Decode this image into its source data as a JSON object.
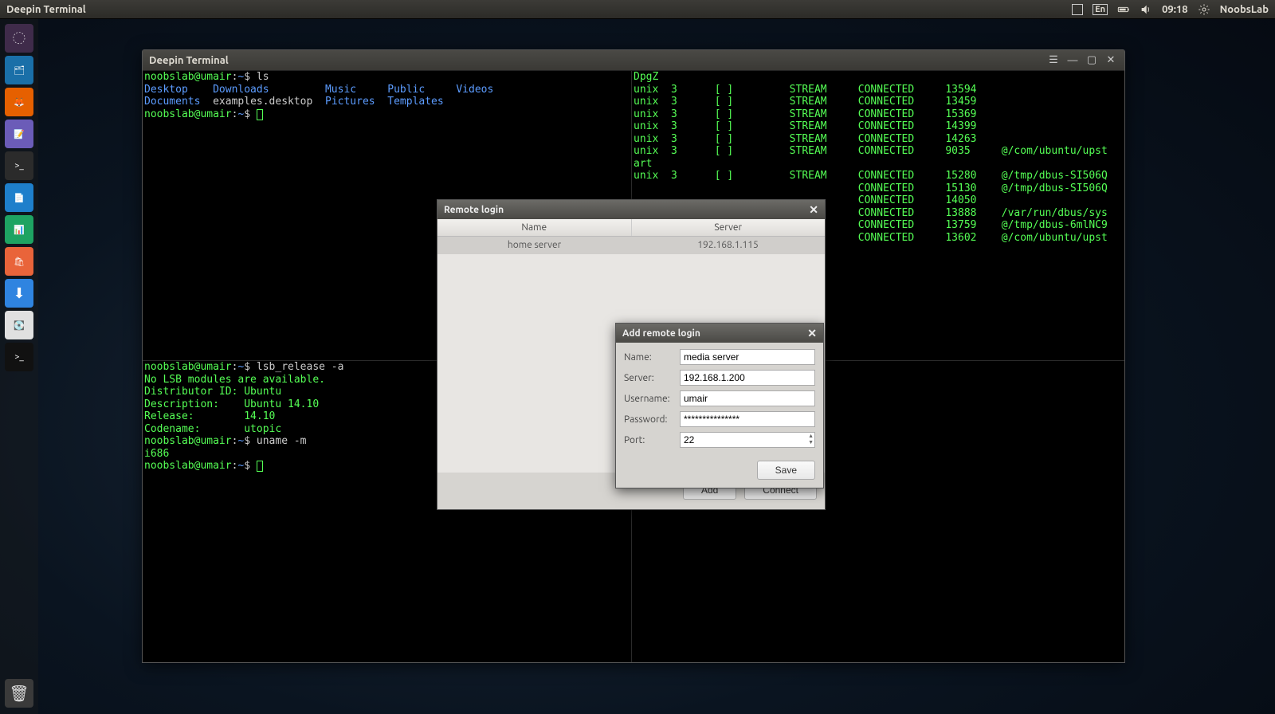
{
  "top_panel": {
    "app_title": "Deepin Terminal",
    "lang": "En",
    "time": "09:18",
    "user": "NoobsLab"
  },
  "launcher": {
    "items": [
      {
        "name": "ubuntu-dash",
        "bg": "#3f2b4a",
        "glyph": "◌"
      },
      {
        "name": "files",
        "bg": "#1a6fa8",
        "glyph": "🗂"
      },
      {
        "name": "firefox",
        "bg": "#e66000",
        "glyph": "🦊"
      },
      {
        "name": "editor",
        "bg": "#6b5cb8",
        "glyph": "📝"
      },
      {
        "name": "terminal",
        "bg": "#2b2b2b",
        "glyph": ">_"
      },
      {
        "name": "writer",
        "bg": "#1e7fcb",
        "glyph": "📄"
      },
      {
        "name": "calc",
        "bg": "#1ea362",
        "glyph": "📊"
      },
      {
        "name": "software",
        "bg": "#e9643a",
        "glyph": "🛍"
      },
      {
        "name": "download",
        "bg": "#2f84e0",
        "glyph": "⬇"
      },
      {
        "name": "disks",
        "bg": "#e0e0e0",
        "glyph": "💽"
      },
      {
        "name": "deepin-terminal",
        "bg": "#111",
        "glyph": ">_"
      }
    ],
    "trash_glyph": "🗑"
  },
  "terminal": {
    "title": "Deepin Terminal",
    "panes": {
      "top_left": [
        {
          "segs": [
            {
              "c": "g",
              "t": "noobslab@umair"
            },
            {
              "c": "w",
              "t": ":"
            },
            {
              "c": "b",
              "t": "~"
            },
            {
              "c": "w",
              "t": "$ ls"
            }
          ]
        },
        {
          "segs": [
            {
              "c": "b",
              "t": "Desktop    Downloads         Music     Public     Videos"
            }
          ]
        },
        {
          "segs": [
            {
              "c": "b",
              "t": "Documents"
            },
            {
              "c": "w",
              "t": "  examples.desktop  "
            },
            {
              "c": "b",
              "t": "Pictures  Templates"
            }
          ]
        },
        {
          "segs": [
            {
              "c": "g",
              "t": "noobslab@umair"
            },
            {
              "c": "w",
              "t": ":"
            },
            {
              "c": "b",
              "t": "~"
            },
            {
              "c": "w",
              "t": "$ "
            }
          ],
          "cursor": true
        }
      ],
      "top_right": [
        {
          "segs": [
            {
              "c": "g",
              "t": "DpgZ"
            }
          ]
        },
        {
          "segs": [
            {
              "c": "g",
              "t": "unix  3      [ ]         STREAM     CONNECTED     13594"
            }
          ]
        },
        {
          "segs": [
            {
              "c": "g",
              "t": "unix  3      [ ]         STREAM     CONNECTED     13459"
            }
          ]
        },
        {
          "segs": [
            {
              "c": "g",
              "t": "unix  3      [ ]         STREAM     CONNECTED     15369"
            }
          ]
        },
        {
          "segs": [
            {
              "c": "g",
              "t": "unix  3      [ ]         STREAM     CONNECTED     14399"
            }
          ]
        },
        {
          "segs": [
            {
              "c": "g",
              "t": "unix  3      [ ]         STREAM     CONNECTED     14263"
            }
          ]
        },
        {
          "segs": [
            {
              "c": "g",
              "t": "unix  3      [ ]         STREAM     CONNECTED     9035     @/com/ubuntu/upst"
            }
          ]
        },
        {
          "segs": [
            {
              "c": "g",
              "t": "art"
            }
          ]
        },
        {
          "segs": [
            {
              "c": "g",
              "t": "unix  3      [ ]         STREAM     CONNECTED     15280    @/tmp/dbus-SI506Q"
            }
          ]
        },
        {
          "segs": [
            {
              "c": "g",
              "t": ""
            }
          ]
        },
        {
          "segs": [
            {
              "c": "g",
              "t": "                                    CONNECTED     15130    @/tmp/dbus-SI506Q"
            }
          ]
        },
        {
          "segs": [
            {
              "c": "g",
              "t": ""
            }
          ]
        },
        {
          "segs": [
            {
              "c": "g",
              "t": "                                    CONNECTED     14050"
            }
          ]
        },
        {
          "segs": [
            {
              "c": "g",
              "t": "                                    CONNECTED     13888    /var/run/dbus/sys"
            }
          ]
        },
        {
          "segs": [
            {
              "c": "g",
              "t": ""
            }
          ]
        },
        {
          "segs": [
            {
              "c": "g",
              "t": "                                    CONNECTED     13759    @/tmp/dbus-6mlNC9"
            }
          ]
        },
        {
          "segs": [
            {
              "c": "g",
              "t": ""
            }
          ]
        },
        {
          "segs": [
            {
              "c": "g",
              "t": "                                    CONNECTED     13602    @/com/ubuntu/upst"
            }
          ]
        }
      ],
      "bottom_left": [
        {
          "segs": [
            {
              "c": "g",
              "t": "noobslab@umair"
            },
            {
              "c": "w",
              "t": ":"
            },
            {
              "c": "b",
              "t": "~"
            },
            {
              "c": "w",
              "t": "$ lsb_release -a"
            }
          ]
        },
        {
          "segs": [
            {
              "c": "g",
              "t": "No LSB modules are available."
            }
          ]
        },
        {
          "segs": [
            {
              "c": "g",
              "t": "Distributor ID: Ubuntu"
            }
          ]
        },
        {
          "segs": [
            {
              "c": "g",
              "t": "Description:    Ubuntu 14.10"
            }
          ]
        },
        {
          "segs": [
            {
              "c": "g",
              "t": "Release:        14.10"
            }
          ]
        },
        {
          "segs": [
            {
              "c": "g",
              "t": "Codename:       utopic"
            }
          ]
        },
        {
          "segs": [
            {
              "c": "g",
              "t": "noobslab@umair"
            },
            {
              "c": "w",
              "t": ":"
            },
            {
              "c": "b",
              "t": "~"
            },
            {
              "c": "w",
              "t": "$ uname -m"
            }
          ]
        },
        {
          "segs": [
            {
              "c": "g",
              "t": "i686"
            }
          ]
        },
        {
          "segs": [
            {
              "c": "g",
              "t": "noobslab@umair"
            },
            {
              "c": "w",
              "t": ":"
            },
            {
              "c": "b",
              "t": "~"
            },
            {
              "c": "w",
              "t": "$ "
            }
          ],
          "cursor": true
        }
      ]
    }
  },
  "remote_login": {
    "title": "Remote login",
    "col_name": "Name",
    "col_server": "Server",
    "rows": [
      {
        "name": "home server",
        "server": "192.168.1.115"
      }
    ],
    "btn_add": "Add",
    "btn_connect": "Connect"
  },
  "add_remote": {
    "title": "Add remote login",
    "labels": {
      "name": "Name:",
      "server": "Server:",
      "username": "Username:",
      "password": "Password:",
      "port": "Port:"
    },
    "values": {
      "name": "media server",
      "server": "192.168.1.200",
      "username": "umair",
      "password": "***************",
      "port": "22"
    },
    "btn_save": "Save"
  }
}
